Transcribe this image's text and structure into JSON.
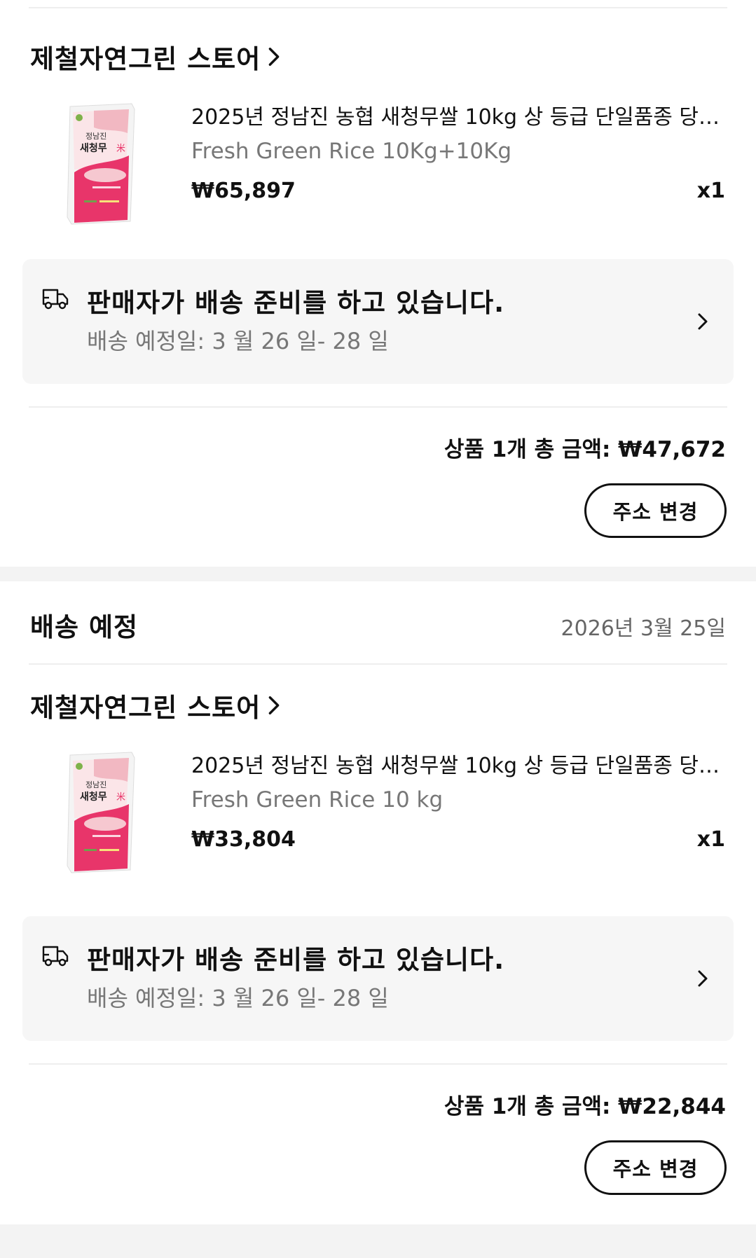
{
  "orders": [
    {
      "store_name": "제철자연그린 스토어",
      "product": {
        "name": "2025년 정남진 농협 새청무쌀 10kg 상 등급 단일품종 당일...",
        "option": "Fresh Green Rice 10Kg+10Kg",
        "price": "₩65,897",
        "qty": "x1",
        "image_icon": "rice-bag-image"
      },
      "shipping": {
        "status": "판매자가 배송 준비를 하고 있습니다.",
        "eta": "배송 예정일: 3 월 26 일- 28 일"
      },
      "total": "상품 1개 총 금액: ₩47,672",
      "address_button": "주소 변경"
    },
    {
      "section_title": "배송 예정",
      "section_date": "2026년 3월 25일",
      "store_name": "제철자연그린 스토어",
      "product": {
        "name": "2025년 정남진 농협 새청무쌀 10kg 상 등급 단일품종 당일...",
        "option": "Fresh Green Rice 10 kg",
        "price": "₩33,804",
        "qty": "x1",
        "image_icon": "rice-bag-image"
      },
      "shipping": {
        "status": "판매자가 배송 준비를 하고 있습니다.",
        "eta": "배송 예정일: 3 월 26 일- 28 일"
      },
      "total": "상품 1개 총 금액: ₩22,844",
      "address_button": "주소 변경"
    }
  ],
  "colors": {
    "text": "#111111",
    "muted": "#777777",
    "card_bg": "#f6f6f6",
    "divider": "#eeeeee",
    "band": "#f3f3f3",
    "bag_pink": "#e8356a",
    "bag_light": "#f2c9cf"
  }
}
